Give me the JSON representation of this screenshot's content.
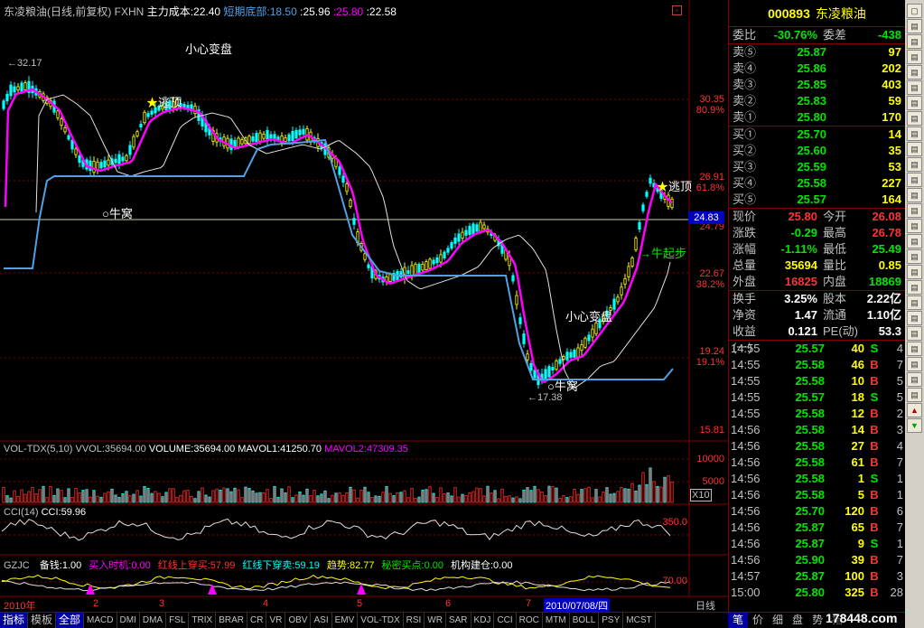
{
  "header": {
    "stock_title": "东凌粮油(日线,前复权)",
    "indicator": "FXHN",
    "cost_label": "主力成本:22.40",
    "bottom_label": "短期底部:18.50",
    "val1": ":25.96",
    "val2": ":25.80",
    "val3": ":22.58"
  },
  "main_chart": {
    "annotations": {
      "careful1": "小心变盘",
      "careful2": "小心变盘",
      "escape1": "逃顶",
      "escape2": "逃顶",
      "nest1": "牛窝",
      "nest2": "牛窝",
      "start": "牛起步",
      "high_mark": "32.17",
      "low_mark": "17.38"
    },
    "price_axis": [
      {
        "value": "30.35",
        "pct": "80.9%"
      },
      {
        "value": "26.91",
        "pct": "61.8%"
      },
      {
        "value": "24.79",
        "pct": ""
      },
      {
        "value": "22.67",
        "pct": "38.2%"
      },
      {
        "value": "19.24",
        "pct": "19.1%"
      },
      {
        "value": "15.81",
        "pct": ""
      }
    ],
    "current_price_tag": "24.83",
    "colors": {
      "main": "#ff00ff",
      "slow": "#ffffff",
      "support": "#50a0e6",
      "candle_up": "#ffff00",
      "candle_dn": "#00ffff"
    }
  },
  "volume_panel": {
    "label": "VOL-TDX(5,10)",
    "vvol": "VVOL:35694.00",
    "volume": "VOLUME:35694.00",
    "mavol1": "MAVOL1:41250.70",
    "mavol2": "MAVOL2:47309.35",
    "axis": [
      "10000",
      "5000",
      "X10"
    ]
  },
  "cci_panel": {
    "label": "CCI(14)",
    "value": "CCI:59.96",
    "axis": "350.0"
  },
  "gzjc_panel": {
    "label": "GZJC",
    "items": [
      {
        "text": "备钱:1.00",
        "color": "#ffffff"
      },
      {
        "text": "买入时机:0.00",
        "color": "#ff00ff"
      },
      {
        "text": "红线上穿买:57.99",
        "color": "#ff3232"
      },
      {
        "text": "红线下穿卖:59.19",
        "color": "#00ffff"
      },
      {
        "text": "趋势:82.77",
        "color": "#ffff00"
      },
      {
        "text": "秘密买点:0.00",
        "color": "#00e600"
      },
      {
        "text": "机构建仓:0.00",
        "color": "#ffffff"
      }
    ],
    "axis": "70.00"
  },
  "date_axis": {
    "year": "2010年",
    "months": [
      "2",
      "3",
      "4",
      "5",
      "6",
      "7",
      "8"
    ],
    "cursor_date": "2010/07/08/四",
    "period": "日线"
  },
  "quote": {
    "code": "000893",
    "name": "东凌粮油",
    "weibi_label": "委比",
    "weibi_value": "-30.76%",
    "weicha_label": "委差",
    "weicha_value": "-438",
    "sell": [
      {
        "label": "卖⑤",
        "price": "25.87",
        "vol": "97"
      },
      {
        "label": "卖④",
        "price": "25.86",
        "vol": "202"
      },
      {
        "label": "卖③",
        "price": "25.85",
        "vol": "403"
      },
      {
        "label": "卖②",
        "price": "25.83",
        "vol": "59"
      },
      {
        "label": "卖①",
        "price": "25.80",
        "vol": "170"
      }
    ],
    "buy": [
      {
        "label": "买①",
        "price": "25.70",
        "vol": "14"
      },
      {
        "label": "买②",
        "price": "25.60",
        "vol": "35"
      },
      {
        "label": "买③",
        "price": "25.59",
        "vol": "53"
      },
      {
        "label": "买④",
        "price": "25.58",
        "vol": "227"
      },
      {
        "label": "买⑤",
        "price": "25.57",
        "vol": "164"
      }
    ],
    "stats": [
      {
        "l1": "现价",
        "v1": "25.80",
        "c1": "red",
        "l2": "今开",
        "v2": "26.08",
        "c2": "red"
      },
      {
        "l1": "涨跌",
        "v1": "-0.29",
        "c1": "green",
        "l2": "最高",
        "v2": "26.78",
        "c2": "red"
      },
      {
        "l1": "涨幅",
        "v1": "-1.11%",
        "c1": "green",
        "l2": "最低",
        "v2": "25.49",
        "c2": "green"
      },
      {
        "l1": "总量",
        "v1": "35694",
        "c1": "yellow",
        "l2": "量比",
        "v2": "0.85",
        "c2": "yellow"
      },
      {
        "l1": "外盘",
        "v1": "16825",
        "c1": "red",
        "l2": "内盘",
        "v2": "18869",
        "c2": "green"
      }
    ],
    "stats2": [
      {
        "l1": "换手",
        "v1": "3.25%",
        "c1": "white",
        "l2": "股本",
        "v2": "2.22亿",
        "c2": "white"
      },
      {
        "l1": "净资",
        "v1": "1.47",
        "c1": "white",
        "l2": "流通",
        "v2": "1.10亿",
        "c2": "white"
      },
      {
        "l1": "收益(一)",
        "v1": "0.121",
        "c1": "white",
        "l2": "PE(动)",
        "v2": "53.3",
        "c2": "white"
      }
    ],
    "ticks": [
      {
        "t": "14:55",
        "p": "25.57",
        "pc": "green",
        "v": "40",
        "bs": "S",
        "bc": "green",
        "n": "4"
      },
      {
        "t": "14:55",
        "p": "25.58",
        "pc": "green",
        "v": "46",
        "bs": "B",
        "bc": "red",
        "n": "7"
      },
      {
        "t": "14:55",
        "p": "25.58",
        "pc": "green",
        "v": "10",
        "bs": "B",
        "bc": "red",
        "n": "5"
      },
      {
        "t": "14:55",
        "p": "25.57",
        "pc": "green",
        "v": "18",
        "bs": "S",
        "bc": "green",
        "n": "5"
      },
      {
        "t": "14:55",
        "p": "25.58",
        "pc": "green",
        "v": "12",
        "bs": "B",
        "bc": "red",
        "n": "2"
      },
      {
        "t": "14:56",
        "p": "25.58",
        "pc": "green",
        "v": "14",
        "bs": "B",
        "bc": "red",
        "n": "3"
      },
      {
        "t": "14:56",
        "p": "25.58",
        "pc": "green",
        "v": "27",
        "bs": "B",
        "bc": "red",
        "n": "4"
      },
      {
        "t": "14:56",
        "p": "25.58",
        "pc": "green",
        "v": "61",
        "bs": "B",
        "bc": "red",
        "n": "7"
      },
      {
        "t": "14:56",
        "p": "25.58",
        "pc": "green",
        "v": "1",
        "bs": "S",
        "bc": "green",
        "n": "1"
      },
      {
        "t": "14:56",
        "p": "25.58",
        "pc": "green",
        "v": "5",
        "bs": "B",
        "bc": "red",
        "n": "1"
      },
      {
        "t": "14:56",
        "p": "25.70",
        "pc": "green",
        "v": "120",
        "bs": "B",
        "bc": "red",
        "n": "6"
      },
      {
        "t": "14:56",
        "p": "25.87",
        "pc": "green",
        "v": "65",
        "bs": "B",
        "bc": "red",
        "n": "7"
      },
      {
        "t": "14:56",
        "p": "25.87",
        "pc": "green",
        "v": "9",
        "bs": "S",
        "bc": "green",
        "n": "1"
      },
      {
        "t": "14:56",
        "p": "25.90",
        "pc": "green",
        "v": "39",
        "bs": "B",
        "bc": "red",
        "n": "7"
      },
      {
        "t": "14:57",
        "p": "25.87",
        "pc": "green",
        "v": "100",
        "bs": "B",
        "bc": "red",
        "n": "3"
      },
      {
        "t": "15:00",
        "p": "25.80",
        "pc": "green",
        "v": "325",
        "bs": "B",
        "bc": "red",
        "n": "28"
      }
    ]
  },
  "quote_tabs": [
    "笔",
    "价",
    "细",
    "盘",
    "势",
    "指"
  ],
  "bottom_tabs": [
    "指标",
    "模板",
    "全部",
    "MACD",
    "DMI",
    "DMA",
    "FSL",
    "TRIX",
    "BRAR",
    "CR",
    "VR",
    "OBV",
    "ASI",
    "EMV",
    "VOL-TDX",
    "RSI",
    "WR",
    "SAR",
    "KDJ",
    "CCI",
    "ROC",
    "MTM",
    "BOLL",
    "PSY",
    "MCST"
  ],
  "watermark": "178448.com",
  "toolbar_icons": [
    "window-icon",
    "chart-icon",
    "chart-icon",
    "chart-icon",
    "chart-icon",
    "chart-icon",
    "chart-icon",
    "chart-icon",
    "chart-icon",
    "chart-icon",
    "chart-icon",
    "chart-icon",
    "chart-icon",
    "chart-icon",
    "chart-icon",
    "chart-icon",
    "chart-icon",
    "chart-icon",
    "chart-icon",
    "chart-icon",
    "chart-icon",
    "chart-icon",
    "chart-icon",
    "chart-icon",
    "chart-icon",
    "chart-icon",
    "arrow-up-icon",
    "arrow-down-icon"
  ]
}
